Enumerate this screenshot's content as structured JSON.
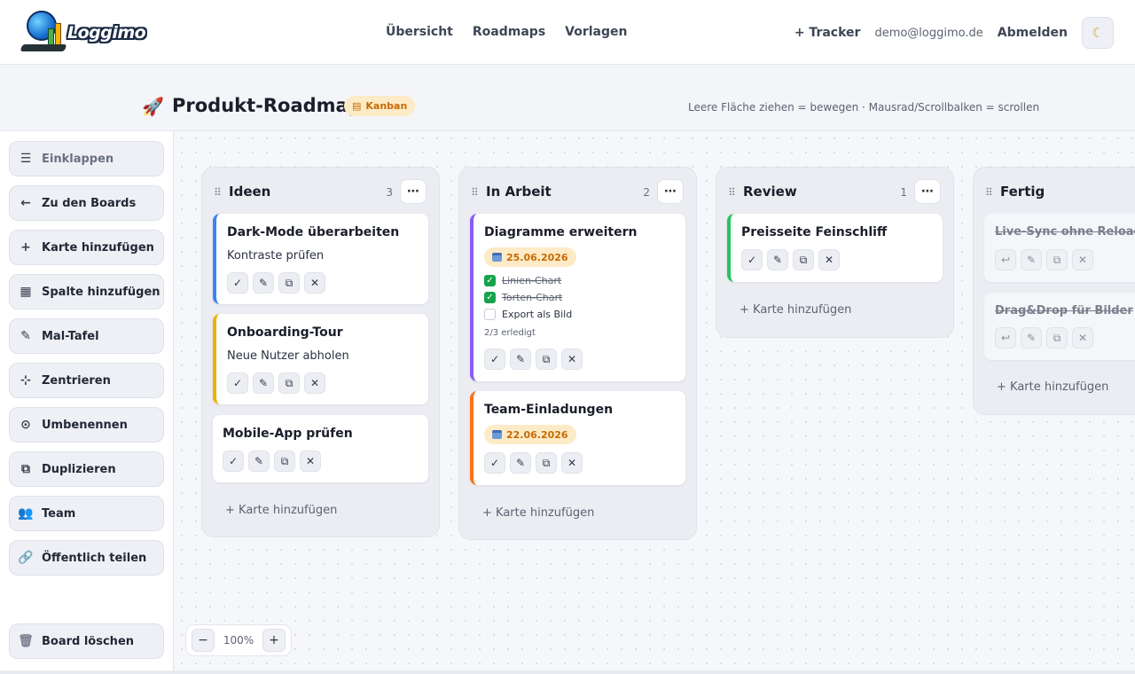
{
  "app": {
    "logo_text": "Loggimo"
  },
  "nav": {
    "links": [
      "Übersicht",
      "Roadmaps",
      "Vorlagen"
    ],
    "tracker": "+ Tracker",
    "email": "demo@loggimo.de",
    "logout": "Abmelden",
    "theme_icon": "moon-icon"
  },
  "board": {
    "title": "Produkt-Roadmap",
    "view_badge": "Kanban",
    "hint": "Leere Fläche ziehen = bewegen · Mausrad/Scrollbalken = scrollen"
  },
  "sidebar": {
    "items": [
      {
        "label": "Einklappen",
        "icon": "hamburger-icon"
      },
      {
        "label": "Zu den Boards",
        "icon": "arrow-left-icon"
      },
      {
        "label": "Karte hinzufügen",
        "icon": "plus-icon"
      },
      {
        "label": "Spalte hinzufügen",
        "icon": "grid-icon"
      },
      {
        "label": "Mal-Tafel",
        "icon": "brush-icon"
      },
      {
        "label": "Zentrieren",
        "icon": "center-icon"
      },
      {
        "label": "Umbenennen",
        "icon": "rename-icon"
      },
      {
        "label": "Duplizieren",
        "icon": "duplicate-icon"
      },
      {
        "label": "Team",
        "icon": "team-icon"
      },
      {
        "label": "Öffentlich teilen",
        "icon": "link-icon"
      }
    ],
    "delete_label": "Board löschen"
  },
  "columns": [
    {
      "title": "Ideen",
      "count": "3",
      "add_label": "+ Karte hinzufügen",
      "cards": [
        {
          "title": "Dark-Mode überarbeiten",
          "desc": "Kontraste prüfen",
          "accent": "#3b82f6"
        },
        {
          "title": "Onboarding-Tour",
          "desc": "Neue Nutzer abholen",
          "accent": "#eab308"
        },
        {
          "title": "Mobile-App prüfen",
          "desc": "",
          "accent": ""
        }
      ]
    },
    {
      "title": "In Arbeit",
      "count": "2",
      "add_label": "+ Karte hinzufügen",
      "cards": [
        {
          "title": "Diagramme erweitern",
          "date": "25.06.2026",
          "accent": "#8b5cf6",
          "checklist": [
            {
              "label": "Linien-Chart",
              "done": true
            },
            {
              "label": "Torten-Chart",
              "done": true
            },
            {
              "label": "Export als Bild",
              "done": false
            }
          ],
          "progress": "2/3 erledigt"
        },
        {
          "title": "Team-Einladungen",
          "date": "22.06.2026",
          "accent": "#f97316"
        }
      ]
    },
    {
      "title": "Review",
      "count": "1",
      "add_label": "+ Karte hinzufügen",
      "cards": [
        {
          "title": "Preisseite Feinschliff",
          "accent": "#22c55e"
        }
      ]
    },
    {
      "title": "Fertig",
      "count": "",
      "add_label": "+ Karte hinzufügen",
      "cards": [
        {
          "title": "Live-Sync ohne Reload"
        },
        {
          "title": "Drag&Drop für Bilder"
        }
      ]
    }
  ],
  "zoom": {
    "value": "100%",
    "minus": "−",
    "plus": "+"
  }
}
